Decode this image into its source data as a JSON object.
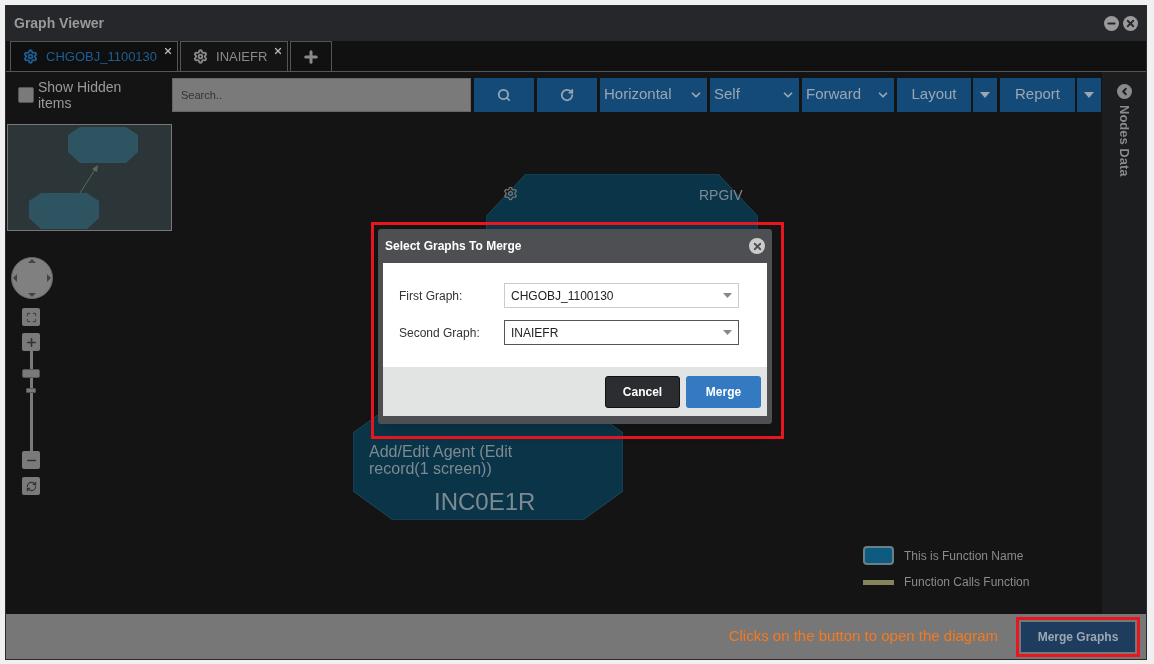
{
  "window": {
    "title": "Graph Viewer"
  },
  "tabs": [
    {
      "label": "CHGOBJ_1100130",
      "selected": true
    },
    {
      "label": "INAIEFR",
      "selected": false
    }
  ],
  "toolbar": {
    "show_hidden": {
      "label": "Show Hidden items",
      "checked": false
    },
    "search": {
      "placeholder": "Search.."
    },
    "controls": [
      {
        "kind": "search"
      },
      {
        "kind": "refresh"
      },
      {
        "kind": "dropdown",
        "label": "Horizontal"
      },
      {
        "kind": "dropdown",
        "label": "Self"
      },
      {
        "kind": "dropdown",
        "label": "Forward"
      },
      {
        "kind": "split",
        "label": "Layout"
      },
      {
        "kind": "split",
        "label": "Report"
      }
    ]
  },
  "side_panel": {
    "title": "Nodes Data"
  },
  "nodes": [
    {
      "tag": "RPGIV"
    },
    {
      "name": "Add/Edit Agent (Edit record(1 screen))",
      "code": "INC0E1R"
    }
  ],
  "legend": [
    {
      "kind": "node",
      "label": "This is Function Name"
    },
    {
      "kind": "edge",
      "label": "Function Calls Function"
    }
  ],
  "dialog": {
    "title": "Select Graphs To Merge",
    "fields": [
      {
        "label": "First Graph:",
        "value": "CHGOBJ_1100130"
      },
      {
        "label": "Second Graph:",
        "value": "INAIEFR"
      }
    ],
    "buttons": [
      {
        "label": "Cancel",
        "kind": "secondary"
      },
      {
        "label": "Merge",
        "kind": "primary"
      }
    ]
  },
  "footer": {
    "note": "Clicks on the button to open the diagram",
    "button": "Merge Graphs"
  }
}
